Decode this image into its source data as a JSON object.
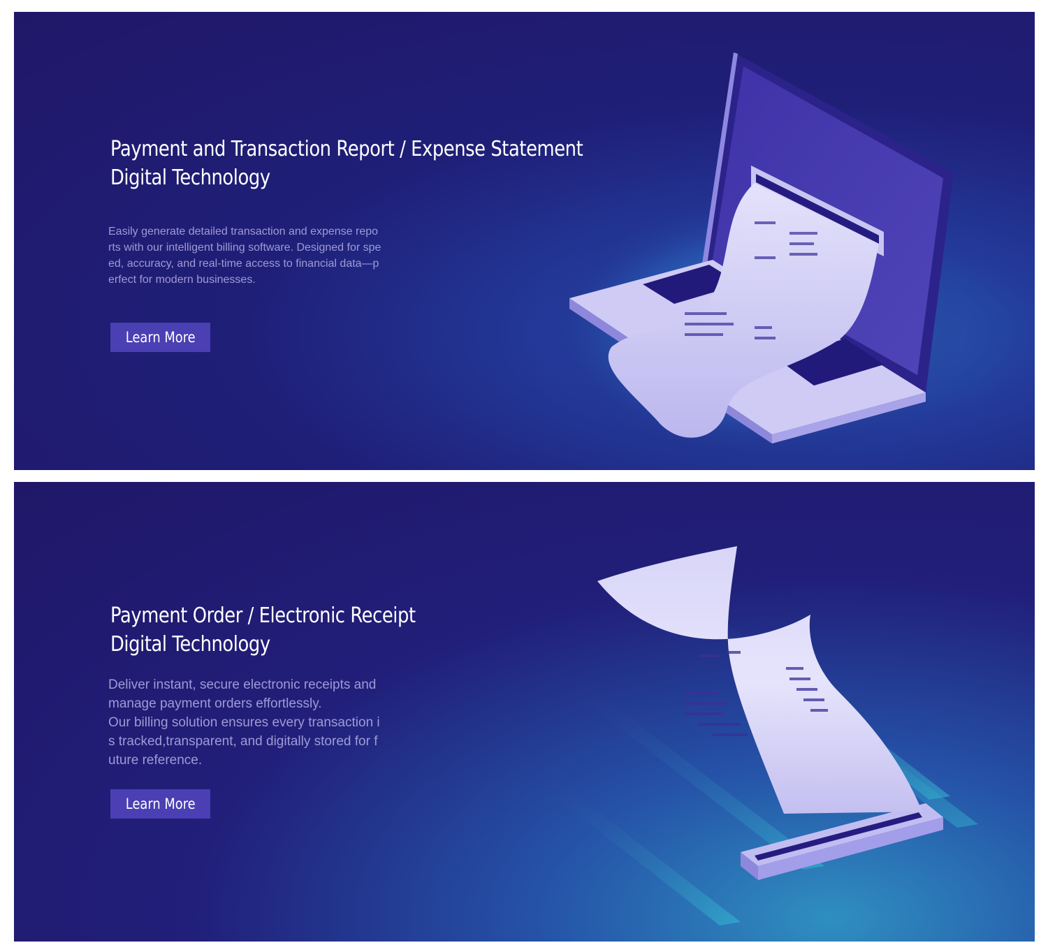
{
  "banners": [
    {
      "title_line1": "Payment and Transaction Report / Expense Statement",
      "title_line2": "Digital Technology",
      "description_lines": [
        "Easily generate detailed transaction and expense repo",
        "rts with our intelligent billing software. Designed for spe",
        "ed, accuracy, and real-time access to financial data—p",
        "erfect for modern businesses."
      ],
      "button_label": "Learn More",
      "illustration_icon": "laptop-receipt-icon"
    },
    {
      "title_line1": "Payment Order / Electronic Receipt",
      "title_line2": "Digital Technology",
      "description_lines": [
        "Deliver instant, secure electronic receipts and",
        "manage payment orders effortlessly.",
        "Our billing solution ensures every transaction i",
        "s tracked,transparent, and digitally stored for f",
        "uture reference."
      ],
      "button_label": "Learn More",
      "illustration_icon": "receipt-scroll-icon"
    }
  ],
  "colors": {
    "background": "#201768",
    "accent_glow": "#2f8fc0",
    "button": "#4a3fb3",
    "paper": "#d9d6f7",
    "text_primary": "#ffffff",
    "text_secondary": "#b5b0e6"
  }
}
